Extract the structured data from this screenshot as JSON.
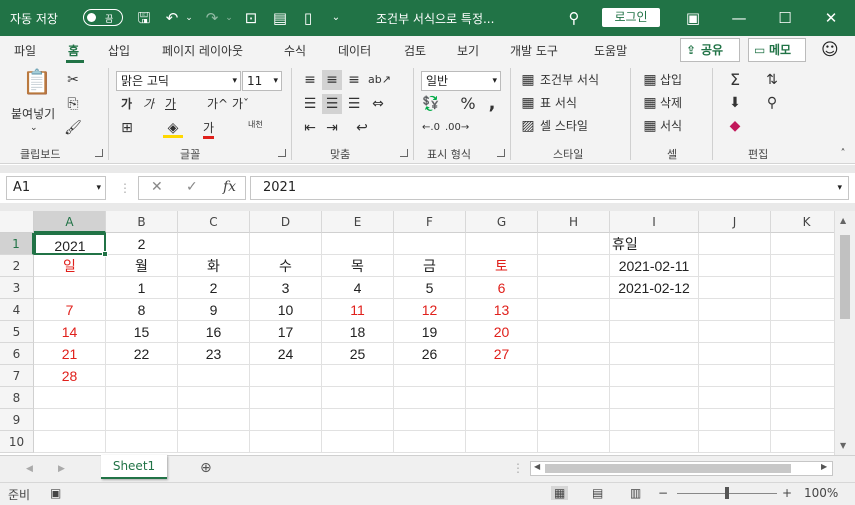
{
  "titlebar": {
    "autosave_label": "자동 저장",
    "autosave_state": "끔",
    "doc_title": "조건부 서식으로 특정...",
    "login_label": "로그인"
  },
  "menu": {
    "items": [
      "파일",
      "홈",
      "삽입",
      "페이지 레이아웃",
      "수식",
      "데이터",
      "검토",
      "보기",
      "개발 도구",
      "도움말"
    ],
    "share_label": "공유",
    "memo_label": "메모"
  },
  "ribbon": {
    "clipboard": {
      "paste_label": "붙여넣기",
      "group_label": "클립보드"
    },
    "font": {
      "font_name": "맑은 고딕",
      "font_size": "11",
      "group_label": "글꼴",
      "bold": "가",
      "italic": "가",
      "underline": "가",
      "grow": "가^",
      "shrink": "가ˇ",
      "color_a": "가",
      "phonetic": "내천"
    },
    "align": {
      "group_label": "맞춤"
    },
    "number": {
      "format": "일반",
      "group_label": "표시 형식"
    },
    "styles": {
      "conditional": "조건부 서식",
      "table": "표 서식",
      "cell": "셀 스타일",
      "group_label": "스타일"
    },
    "cells": {
      "insert": "삽입",
      "delete": "삭제",
      "format": "서식",
      "group_label": "셀"
    },
    "editing": {
      "group_label": "편집"
    }
  },
  "formula_bar": {
    "name_box": "A1",
    "value": "2021"
  },
  "grid": {
    "columns": [
      "A",
      "B",
      "C",
      "D",
      "E",
      "F",
      "G",
      "H",
      "I",
      "J",
      "K"
    ],
    "rows": [
      "1",
      "2",
      "3",
      "4",
      "5",
      "6",
      "7",
      "8",
      "9",
      "10"
    ],
    "r1": {
      "A": "2021",
      "B": "2",
      "I": "휴일"
    },
    "r2": {
      "A": "일",
      "B": "월",
      "C": "화",
      "D": "수",
      "E": "목",
      "F": "금",
      "G": "토",
      "I": "2021-02-11"
    },
    "r3": {
      "B": "1",
      "C": "2",
      "D": "3",
      "E": "4",
      "F": "5",
      "G": "6",
      "I": "2021-02-12"
    },
    "r4": {
      "A": "7",
      "B": "8",
      "C": "9",
      "D": "10",
      "E": "11",
      "F": "12",
      "G": "13"
    },
    "r5": {
      "A": "14",
      "B": "15",
      "C": "16",
      "D": "17",
      "E": "18",
      "F": "19",
      "G": "20"
    },
    "r6": {
      "A": "21",
      "B": "22",
      "C": "23",
      "D": "24",
      "E": "25",
      "F": "26",
      "G": "27"
    },
    "r7": {
      "A": "28"
    }
  },
  "colors": {
    "accent": "#217346",
    "red_text": "#e0201b"
  },
  "sheet": {
    "tab_name": "Sheet1"
  },
  "status": {
    "ready": "준비",
    "zoom": "100%"
  }
}
